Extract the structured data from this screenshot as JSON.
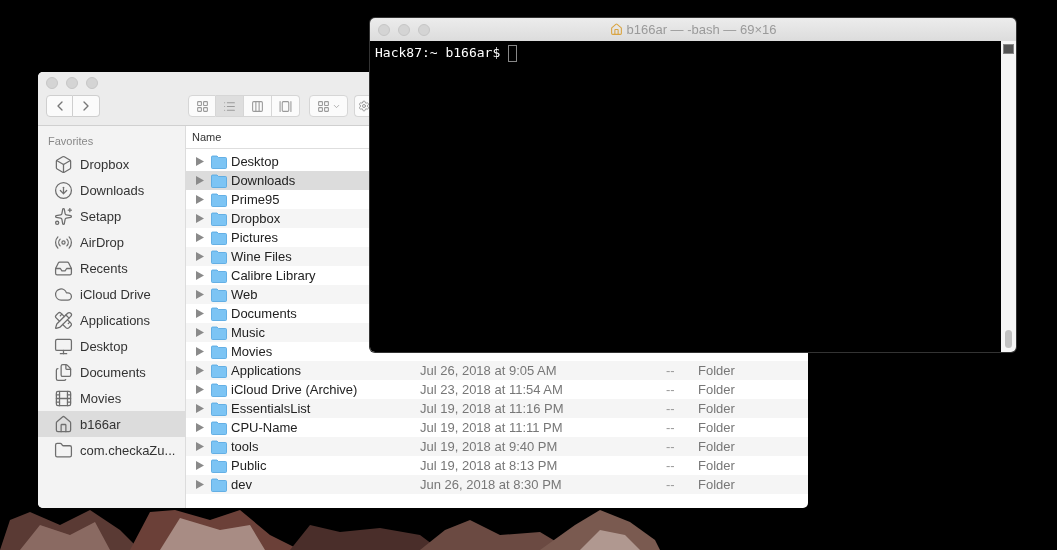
{
  "finder": {
    "view_modes": [
      {
        "kind": "icons",
        "selected": false
      },
      {
        "kind": "list",
        "selected": true
      },
      {
        "kind": "columns",
        "selected": false
      },
      {
        "kind": "gallery",
        "selected": false
      }
    ],
    "sidebar": {
      "heading": "Favorites",
      "items": [
        {
          "label": "Dropbox",
          "kind": "dropbox",
          "selected": false
        },
        {
          "label": "Downloads",
          "kind": "downloads",
          "selected": false
        },
        {
          "label": "Setapp",
          "kind": "setapp",
          "selected": false
        },
        {
          "label": "AirDrop",
          "kind": "airdrop",
          "selected": false
        },
        {
          "label": "Recents",
          "kind": "recents",
          "selected": false
        },
        {
          "label": "iCloud Drive",
          "kind": "cloud",
          "selected": false
        },
        {
          "label": "Applications",
          "kind": "apps",
          "selected": false
        },
        {
          "label": "Desktop",
          "kind": "desktop",
          "selected": false
        },
        {
          "label": "Documents",
          "kind": "documents",
          "selected": false
        },
        {
          "label": "Movies",
          "kind": "movies",
          "selected": false
        },
        {
          "label": "b166ar",
          "kind": "home",
          "selected": true
        },
        {
          "label": "com.checkaZu...",
          "kind": "folder",
          "selected": false
        }
      ]
    },
    "list": {
      "column": "Name",
      "rows": [
        {
          "name": "Desktop",
          "selected": false
        },
        {
          "name": "Downloads",
          "selected": true
        },
        {
          "name": "Prime95",
          "selected": false
        },
        {
          "name": "Dropbox",
          "selected": false
        },
        {
          "name": "Pictures",
          "selected": false
        },
        {
          "name": "Wine Files",
          "selected": false
        },
        {
          "name": "Calibre Library",
          "selected": false
        },
        {
          "name": "Web",
          "selected": false
        },
        {
          "name": "Documents",
          "selected": false
        },
        {
          "name": "Music",
          "selected": false
        },
        {
          "name": "Movies",
          "selected": false
        },
        {
          "name": "Applications",
          "selected": false,
          "date": "Jul 26, 2018 at 9:05 AM",
          "size": "--",
          "file_kind": "Folder"
        },
        {
          "name": "iCloud Drive (Archive)",
          "selected": false,
          "date": "Jul 23, 2018 at 11:54 AM",
          "size": "--",
          "file_kind": "Folder"
        },
        {
          "name": "EssentialsList",
          "selected": false,
          "date": "Jul 19, 2018 at 11:16 PM",
          "size": "--",
          "file_kind": "Folder"
        },
        {
          "name": "CPU-Name",
          "selected": false,
          "date": "Jul 19, 2018 at 11:11 PM",
          "size": "--",
          "file_kind": "Folder"
        },
        {
          "name": "tools",
          "selected": false,
          "date": "Jul 19, 2018 at 9:40 PM",
          "size": "--",
          "file_kind": "Folder"
        },
        {
          "name": "Public",
          "selected": false,
          "date": "Jul 19, 2018 at 8:13 PM",
          "size": "--",
          "file_kind": "Folder"
        },
        {
          "name": "dev",
          "selected": false,
          "date": "Jun 26, 2018 at 8:30 PM",
          "size": "--",
          "file_kind": "Folder"
        }
      ]
    }
  },
  "terminal": {
    "title": "b166ar — -bash — 69×16",
    "prompt": "Hack87:~ b166ar$"
  }
}
